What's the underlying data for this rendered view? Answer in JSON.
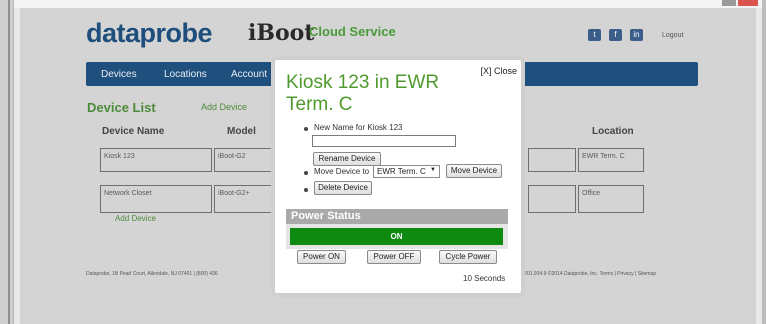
{
  "header": {
    "logo_text": "dataprobe",
    "product_logo": "iBoot",
    "service_label": "Cloud Service",
    "social_icons": [
      "twitter-icon",
      "facebook-icon",
      "linkedin-icon"
    ],
    "logout_label": "Logout"
  },
  "nav": {
    "items": [
      "Devices",
      "Locations",
      "Account"
    ]
  },
  "device_list": {
    "title": "Device List",
    "add_device_top": "Add Device",
    "columns": [
      "Device Name",
      "Model",
      "Location"
    ],
    "rows": [
      {
        "name": "Kiosk 123",
        "model": "iBoot-G2",
        "location": "EWR Term. C"
      },
      {
        "name": "Network Closet",
        "model": "iBoot-G2+",
        "location": "Office"
      }
    ],
    "add_device_bottom": "Add Device"
  },
  "footer": {
    "left": "Dataprobe, 1B Pearl Court, Allendale, NJ 07401 | (800) 436",
    "right": "1.201.934.9 ©2014 Dataprobe, Inc. Terms | Privacy | Sitemap"
  },
  "modal": {
    "close_label": "[X] Close",
    "title": "Kiosk 123 in EWR Term. C",
    "new_name_label": "New Name for Kiosk 123",
    "new_name_value": "",
    "rename_button": "Rename Device",
    "move_label": "Move Device to",
    "move_selected": "EWR Term. C",
    "move_button": "Move Device",
    "delete_button": "Delete Device",
    "power_status_label": "Power Status",
    "power_state": "ON",
    "power_on_button": "Power ON",
    "power_off_button": "Power OFF",
    "cycle_power_button": "Cycle Power",
    "cycle_duration": "10 Seconds"
  },
  "colors": {
    "nav_bg": "#1f4f7d",
    "accent_green": "#4f9a2e",
    "power_on_bg": "#0e8a10"
  }
}
